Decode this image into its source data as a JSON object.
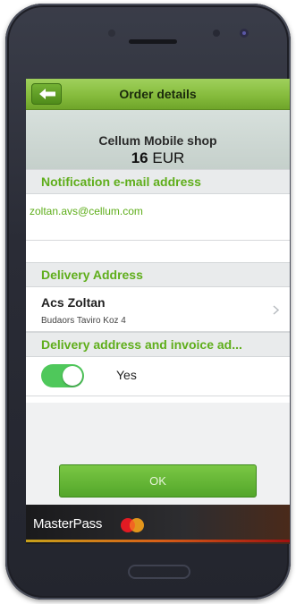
{
  "header": {
    "title": "Order details",
    "back_icon": "arrow-left-icon"
  },
  "shop": {
    "name": "Cellum Mobile shop",
    "amount": "16",
    "currency": "EUR"
  },
  "notification": {
    "section_title": "Notification e-mail address",
    "email": "zoltan.avs@cellum.com"
  },
  "delivery": {
    "section_title": "Delivery Address",
    "name": "Acs Zoltan",
    "street": "Budaors Taviro Koz 4",
    "chevron_icon": "chevron-right-icon"
  },
  "invoice": {
    "section_title": "Delivery address and invoice ad...",
    "toggle_on": true,
    "toggle_label": "Yes"
  },
  "actions": {
    "ok_label": "OK"
  },
  "footer": {
    "brand": "MasterPass",
    "logo_icon": "mastercard-logo-icon"
  },
  "colors": {
    "accent_green": "#5fae1b",
    "toggle_green": "#4fc85b"
  }
}
